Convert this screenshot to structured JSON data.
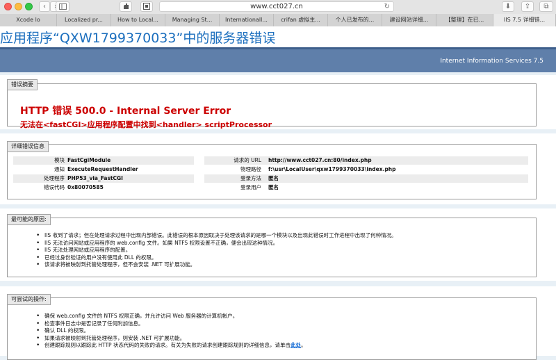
{
  "browser": {
    "url": "www.cct027.cn",
    "tabs": [
      {
        "label": "Xcode lo"
      },
      {
        "label": "Localized pr..."
      },
      {
        "label": "How to Local..."
      },
      {
        "label": "Managing St..."
      },
      {
        "label": "Internationall..."
      },
      {
        "label": "crifan 虚拟主..."
      },
      {
        "label": "个人已发布的..."
      },
      {
        "label": "建设网站详细..."
      },
      {
        "label": "【整理】在已..."
      },
      {
        "label": "IIS 7.5 详细错..."
      }
    ]
  },
  "page": {
    "title": "应用程序“QXW1799370033”中的服务器错误",
    "product": "Internet Information Services 7.5",
    "summary": {
      "legend": "错误摘要",
      "error_title": "HTTP 错误 500.0 - Internal Server Error",
      "error_message": "无法在<fastCGI>应用程序配置中找到<handler> scriptProcessor"
    },
    "details": {
      "legend": "详细错误信息",
      "left": [
        {
          "key": "模块",
          "value": "FastCgiModule"
        },
        {
          "key": "通知",
          "value": "ExecuteRequestHandler"
        },
        {
          "key": "处理程序",
          "value": "PHP53_via_FastCGI"
        },
        {
          "key": "错误代码",
          "value": "0x80070585"
        }
      ],
      "right": [
        {
          "key": "请求的 URL",
          "value": "http://www.cct027.cn:80/index.php"
        },
        {
          "key": "物理路径",
          "value": "f:\\usr\\LocalUser\\qxw1799370033\\index.php"
        },
        {
          "key": "登录方法",
          "value": "匿名"
        },
        {
          "key": "登录用户",
          "value": "匿名"
        }
      ]
    },
    "causes": {
      "legend": "最可能的原因:",
      "items": [
        "IIS 收到了请求；但在处理请求过程中出现内部错误。此错误的根本原因取决于处理该请求的是哪一个模块以及出现此错误时工作进程中出现了何种情况。",
        "IIS 无法访问网站或应用程序的 web.config 文件。如果 NTFS 权限设置不正确，便会出现这种情况。",
        "IIS 无法处理网站或应用程序的配置。",
        "已经过身份验证的用户没有使用此 DLL 的权限。",
        "该请求将被映射到托管处理程序，但不会安装 .NET 可扩展功能。"
      ]
    },
    "actions": {
      "legend": "可尝试的操作:",
      "items": [
        "确保 web.config 文件的 NTFS 权限正确，并允许访问 Web 服务器的计算机帐户。",
        "检查事件日志中是否记录了任何附加信息。",
        "确认 DLL 的权限。",
        "如果请求被映射到托管处理程序，则安装 .NET 可扩展功能。"
      ],
      "last_item_text": "创建跟踪规则以跟踪此 HTTP 状态代码的失败的请求。有关为失败的请求创建跟踪规则的详细信息，请单击",
      "link_text": "此处",
      "last_item_end": "。"
    }
  },
  "colors": {
    "title_blue": "#1c6fbe",
    "band_blue": "#5f7faa",
    "error_red": "#cc0000",
    "link_blue": "#1a6fd6"
  }
}
